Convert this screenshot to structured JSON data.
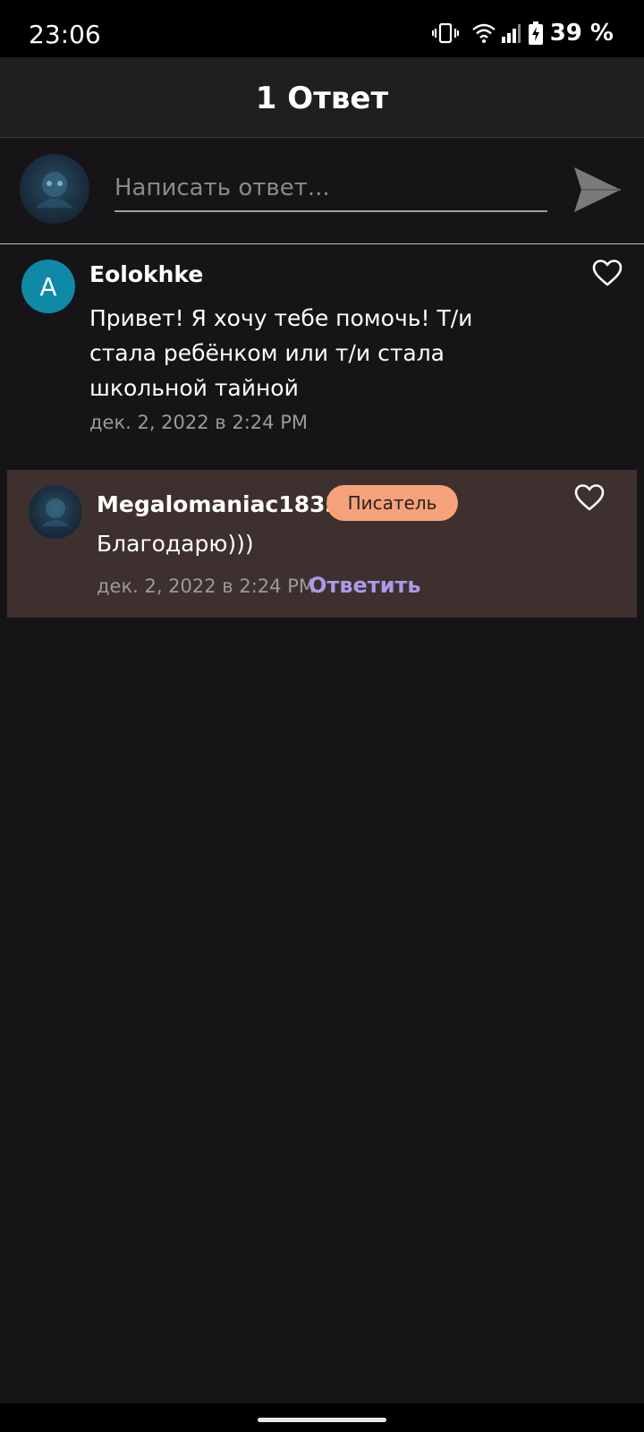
{
  "status_bar": {
    "time": "23:06",
    "battery_percent": "39 %",
    "icons": [
      "vibrate-icon",
      "wifi-icon",
      "signal-icon",
      "battery-charging-icon"
    ]
  },
  "header": {
    "title": "1 Ответ"
  },
  "composer": {
    "placeholder": "Написать ответ...",
    "send_icon": "send-icon"
  },
  "comment": {
    "avatar_letter": "A",
    "author": "Eolokhke",
    "text": "Привет! Я  хочу тебе помочь! Т/и стала ребёнком или т/и стала школьной тайной",
    "date": "дек. 2, 2022 в 2:24 PM",
    "like_icon": "heart-icon"
  },
  "reply": {
    "author": "Megalomaniac1833",
    "badge": "Писатель",
    "text": "Благодарю)))",
    "date": "дек. 2, 2022 в 2:24 PM",
    "action": "Ответить",
    "like_icon": "heart-icon"
  },
  "colors": {
    "background": "#161417",
    "header": "#201e21",
    "reply_highlight": "#3e302e",
    "badge": "#f5a27a",
    "reply_action": "#a89be8",
    "avatar_letter_bg": "#0e8aa6"
  }
}
